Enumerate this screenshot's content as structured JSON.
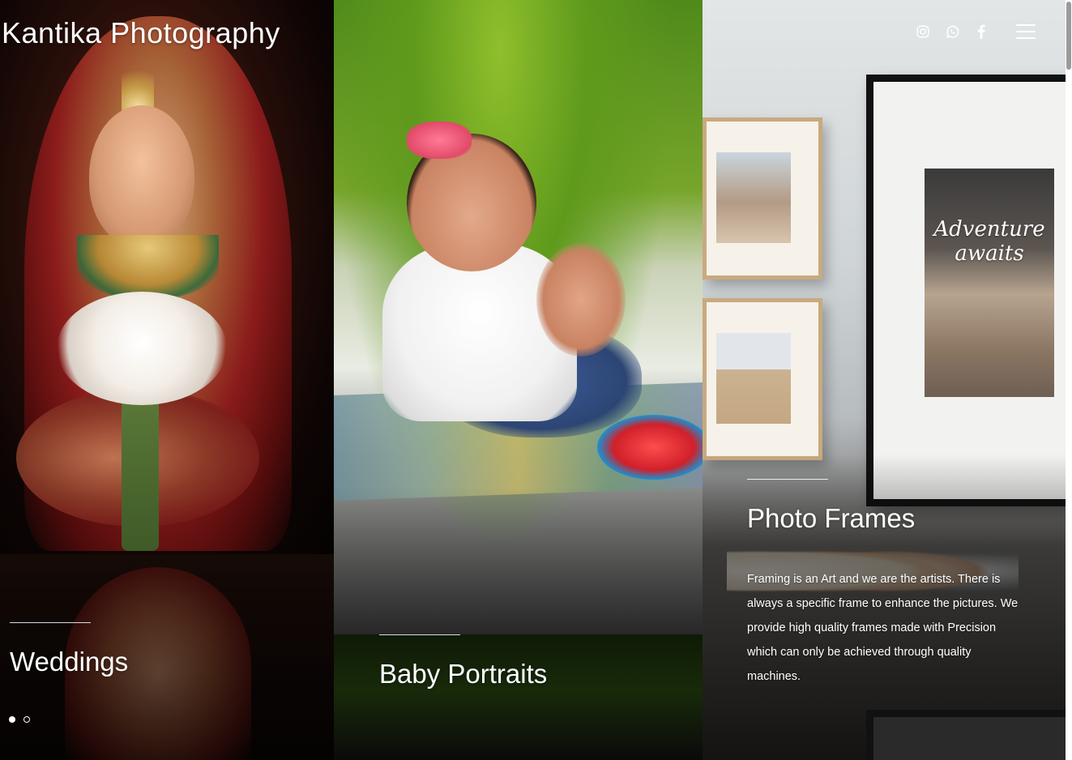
{
  "site": {
    "title": "Kantika Photography"
  },
  "header": {
    "icons": [
      "instagram-icon",
      "whatsapp-icon",
      "facebook-icon"
    ],
    "menu_icon": "hamburger-menu-icon"
  },
  "panels": [
    {
      "caption": "Weddings"
    },
    {
      "caption": "Baby Portraits"
    },
    {
      "caption": "Photo Frames",
      "description": "Framing is an Art and we are the artists. There is always a specific frame to enhance the pictures. We provide high quality frames made with Precision which can only be achieved through quality machines."
    }
  ],
  "frame_art": {
    "text": "Adventure awaits"
  },
  "slider": {
    "count": 2,
    "active_index": 0
  },
  "colors": {
    "text": "#ffffff",
    "rule": "#ffffff"
  }
}
